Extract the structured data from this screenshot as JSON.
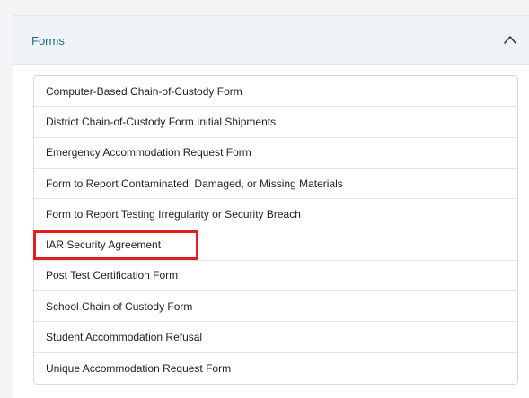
{
  "forms_panel": {
    "title": "Forms",
    "toggle_icon": "chevron-up-icon",
    "items": [
      "Computer-Based Chain-of-Custody Form",
      "District Chain-of-Custody Form Initial Shipments",
      "Emergency Accommodation Request Form",
      "Form to Report Contaminated, Damaged, or Missing Materials",
      "Form to Report Testing Irregularity or Security Breach",
      "IAR Security Agreement",
      "Post Test Certification Form",
      "School Chain of Custody Form",
      "Student Accommodation Refusal",
      "Unique Accommodation Request Form"
    ]
  },
  "colors": {
    "header_background": "#eef4f5",
    "title_text": "#1c6d8c",
    "highlight_border": "#e02020",
    "list_border": "#d9dcdf"
  }
}
